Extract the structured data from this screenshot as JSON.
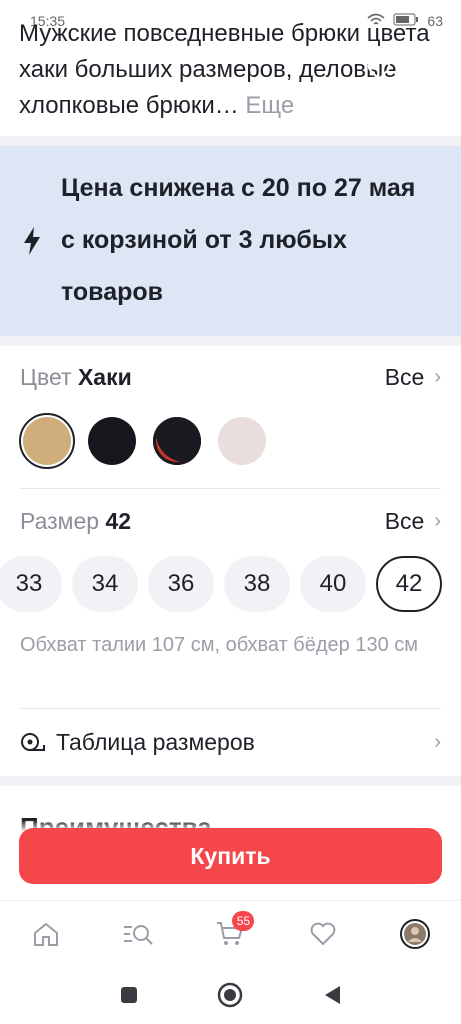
{
  "status": {
    "time": "15:35",
    "battery": "63"
  },
  "product": {
    "title": "Мужские повседневные брюки цвета хаки больших размеров, деловые хлопковые брюки…",
    "more": "Еще"
  },
  "promo": {
    "text": "Цена снижена с 20 по 27 мая с корзиной от 3 любых товаров"
  },
  "color": {
    "label": "Цвет",
    "value": "Хаки",
    "all": "Все",
    "swatches": [
      {
        "name": "khaki",
        "color": "#cfae7c",
        "selected": true
      },
      {
        "name": "black",
        "color": "#15171c",
        "selected": false
      },
      {
        "name": "black-red",
        "color": "#1a1b20",
        "selected": false
      },
      {
        "name": "light",
        "color": "#e9dedc",
        "selected": false
      }
    ]
  },
  "size": {
    "label": "Размер",
    "value": "42",
    "all": "Все",
    "options": [
      "33",
      "34",
      "36",
      "38",
      "40",
      "42"
    ],
    "selected": "42",
    "hint": "Обхват талии 107 см, обхват бёдер 130 см"
  },
  "size_table": {
    "label": "Таблица размеров"
  },
  "advantages": {
    "label": "Преимущества"
  },
  "buy": {
    "label": "Купить"
  },
  "tabbar": {
    "cart_count": "55",
    "items": [
      "home-icon",
      "catalog-search-icon",
      "cart-icon",
      "favorites-icon",
      "profile-avatar"
    ]
  },
  "colors": {
    "accent": "#f5474b",
    "promo_bg": "#dde6f5"
  }
}
